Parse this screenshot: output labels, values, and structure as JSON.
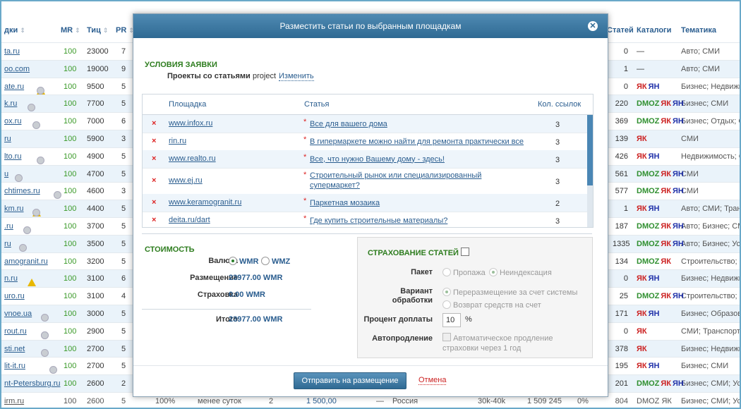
{
  "background": {
    "headers": {
      "site": "дки",
      "mr": "MR",
      "tic": "Тиц",
      "pr": "PR",
      "count": "Статей",
      "catalogs": "Каталоги",
      "theme": "Тематика"
    },
    "rows": [
      {
        "site": "ta.ru",
        "mr": "100",
        "tic": "23000",
        "pr": "7",
        "count": "0",
        "cat": "—",
        "theme": "Авто; СМИ"
      },
      {
        "site": "oo.com",
        "mr": "100",
        "tic": "19000",
        "pr": "9",
        "count": "1",
        "cat": "—",
        "theme": "Авто; СМИ"
      },
      {
        "site": "ate.ru",
        "mr": "100",
        "tic": "9500",
        "pr": "5",
        "count": "0",
        "cat": "ЯК ЯН",
        "theme": "Бизнес; Недвижи"
      },
      {
        "site": "k.ru",
        "mr": "100",
        "tic": "7700",
        "pr": "5",
        "count": "220",
        "cat": "DMOZ ЯК ЯН",
        "theme": "Бизнес; СМИ"
      },
      {
        "site": "ox.ru",
        "mr": "100",
        "tic": "7000",
        "pr": "6",
        "count": "369",
        "cat": "DMOZ ЯК ЯН",
        "theme": "Бизнес; Отдых; С"
      },
      {
        "site": "ru",
        "mr": "100",
        "tic": "5900",
        "pr": "3",
        "count": "139",
        "cat": "ЯК",
        "theme": "СМИ"
      },
      {
        "site": "lto.ru",
        "mr": "100",
        "tic": "4900",
        "pr": "5",
        "count": "426",
        "cat": "ЯК ЯН",
        "theme": "Недвижимость; С"
      },
      {
        "site": "u",
        "mr": "100",
        "tic": "4700",
        "pr": "5",
        "count": "561",
        "cat": "DMOZ ЯК ЯН",
        "theme": "СМИ"
      },
      {
        "site": "chtimes.ru",
        "mr": "100",
        "tic": "4600",
        "pr": "3",
        "count": "577",
        "cat": "DMOZ ЯК ЯН",
        "theme": "СМИ"
      },
      {
        "site": "km.ru",
        "mr": "100",
        "tic": "4400",
        "pr": "5",
        "count": "1",
        "cat": "ЯК ЯН",
        "theme": "Авто; СМИ; Тран"
      },
      {
        "site": ".ru",
        "mr": "100",
        "tic": "3700",
        "pr": "5",
        "count": "187",
        "cat": "DMOZ ЯК ЯН",
        "theme": "Авто; Бизнес; СМ"
      },
      {
        "site": "ru",
        "mr": "100",
        "tic": "3500",
        "pr": "5",
        "count": "1335",
        "cat": "DMOZ ЯК ЯН",
        "theme": "Авто; Бизнес; Ус"
      },
      {
        "site": "amogranit.ru",
        "mr": "100",
        "tic": "3200",
        "pr": "5",
        "count": "134",
        "cat": "DMOZ ЯК",
        "theme": "Строительство; "
      },
      {
        "site": "n.ru",
        "mr": "100",
        "tic": "3100",
        "pr": "6",
        "count": "0",
        "cat": "ЯК ЯН",
        "theme": "Бизнес; Недвижи"
      },
      {
        "site": "uro.ru",
        "mr": "100",
        "tic": "3100",
        "pr": "4",
        "count": "25",
        "cat": "DMOZ ЯК ЯН",
        "theme": "Строительство; "
      },
      {
        "site": "vnoe.ua",
        "mr": "100",
        "tic": "3000",
        "pr": "5",
        "count": "171",
        "cat": "ЯК ЯН",
        "theme": "Бизнес; Образов"
      },
      {
        "site": "rout.ru",
        "mr": "100",
        "tic": "2900",
        "pr": "5",
        "count": "0",
        "cat": "ЯК",
        "theme": "СМИ; Транспорт"
      },
      {
        "site": "sti.net",
        "mr": "100",
        "tic": "2700",
        "pr": "5",
        "count": "378",
        "cat": "ЯК",
        "theme": "Бизнес; Недвижи"
      },
      {
        "site": "lit-it.ru",
        "mr": "100",
        "tic": "2700",
        "pr": "5",
        "count": "195",
        "cat": "ЯК ЯН",
        "theme": "Бизнес; СМИ"
      },
      {
        "site": "nt-Petersburg.ru",
        "mr": "100",
        "tic": "2600",
        "pr": "2",
        "count": "201",
        "cat": "DMOZ ЯК ЯН",
        "theme": "Бизнес; СМИ; Ус"
      }
    ],
    "last_row": {
      "site": "irm.ru",
      "mr": "100",
      "tic": "2600",
      "pr": "5",
      "c1": "100%",
      "c2": "менее суток",
      "c3": "2",
      "c4": "1 500,00",
      "c5": "—",
      "c6": "Россия",
      "c7": "30k-40k",
      "c8": "1 509 245",
      "c9": "0%",
      "count": "804",
      "cat": "DMOZ ЯК",
      "theme": "Бизнес; СМИ; Ус"
    }
  },
  "modal": {
    "title": "Разместить статьи по выбранным площадкам",
    "conditions_title": "УСЛОВИЯ ЗАЯВКИ",
    "projects_label": "Проекты со статьями",
    "project_value": "project",
    "change_link": "Изменить",
    "table": {
      "col_site": "Площадка",
      "col_article": "Статья",
      "col_links": "Кол. ссылок",
      "rows": [
        {
          "site": "www.infox.ru",
          "article": "Все для вашего дома",
          "links": "3"
        },
        {
          "site": "rin.ru",
          "article": "В гипермаркете можно найти для ремонта практически все",
          "links": "3"
        },
        {
          "site": "www.realto.ru",
          "article": "Все, что нужно Вашему дому - здесь!",
          "links": "3"
        },
        {
          "site": "www.ej.ru",
          "article": "Строительный рынок или специализированный супермаркет?",
          "links": "3"
        },
        {
          "site": "www.keramogranit.ru",
          "article": "Паркетная мозаика",
          "links": "2"
        },
        {
          "site": "deita.ru/dart",
          "article": "Где купить строительные материалы?",
          "links": "3"
        }
      ]
    },
    "cost": {
      "title": "СТОИМОСТЬ",
      "currency_label": "Валюта",
      "wmr": "WMR",
      "wmz": "WMZ",
      "placement_label": "Размещение",
      "placement_value": "23977.00 WMR",
      "insurance_label": "Страховка",
      "insurance_value": "0.00 WMR",
      "total_label": "Итого",
      "total_value": "23977.00 WMR"
    },
    "insurance": {
      "title": "СТРАХОВАНИЕ СТАТЕЙ",
      "package_label": "Пакет",
      "package_opt1": "Пропажа",
      "package_opt2": "Неиндексация",
      "variant_label": "Вариант обработки",
      "variant_opt1": "Переразмещение за счет системы",
      "variant_opt2": "Возврат средств на счет",
      "percent_label": "Процент доплаты",
      "percent_value": "10",
      "percent_unit": "%",
      "auto_label": "Автопродление",
      "auto_text": "Автоматическое продление страховки через 1 год"
    },
    "submit": "Отправить на размещение",
    "cancel": "Отмена"
  }
}
